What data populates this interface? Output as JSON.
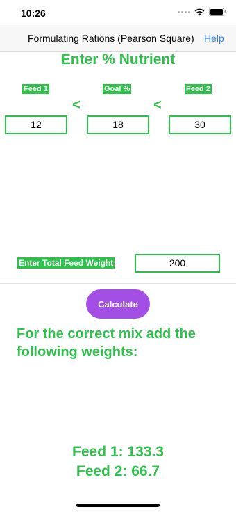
{
  "status_bar": {
    "time": "10:26"
  },
  "nav": {
    "title": "Formulating Rations (Pearson Square)",
    "help": "Help"
  },
  "heading": "Enter % Nutrient",
  "feed1": {
    "label": "Feed 1",
    "value": "12"
  },
  "goal": {
    "label": "Goal %",
    "value": "18"
  },
  "feed2": {
    "label": "Feed 2",
    "value": "30"
  },
  "comparator": "<",
  "total": {
    "label": "Enter Total Feed Weight",
    "value": "200"
  },
  "calculate_label": "Calculate",
  "result_message": "For the correct mix add the following weights:",
  "results": {
    "feed1": "Feed 1: 133.3",
    "feed2": "Feed 2: 66.7"
  },
  "colors": {
    "accent_green": "#2fc14c",
    "button_purple": "#a34fe6",
    "link_blue": "#2f80ed"
  }
}
